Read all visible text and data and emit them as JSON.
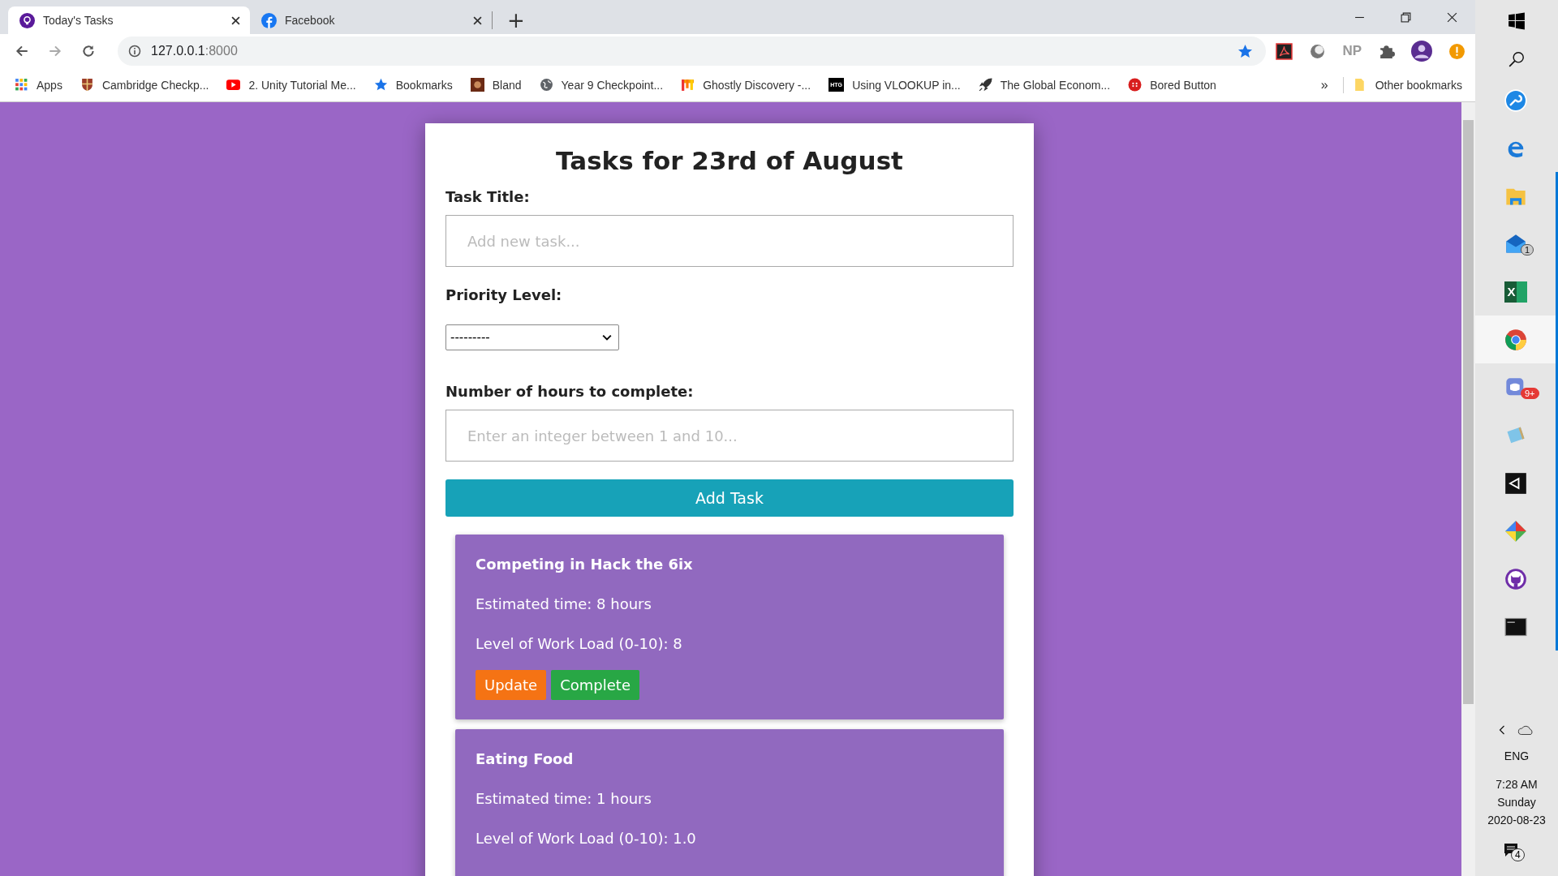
{
  "browser": {
    "tabs": [
      {
        "title": "Today's Tasks",
        "kind": "app",
        "selected": true
      },
      {
        "title": "Facebook",
        "kind": "facebook",
        "selected": false
      }
    ],
    "new_tab": "+",
    "address": {
      "host": "127.0.0.1",
      "port": ":8000"
    },
    "extension_label": "NP",
    "bookmarks": [
      {
        "label": "Apps",
        "kind": "apps"
      },
      {
        "label": "Cambridge Checkp...",
        "kind": "shield"
      },
      {
        "label": "2. Unity Tutorial Me...",
        "kind": "video"
      },
      {
        "label": "Bookmarks",
        "kind": "star"
      },
      {
        "label": "Bland",
        "kind": "photo"
      },
      {
        "label": "Year 9 Checkpoint...",
        "kind": "globe"
      },
      {
        "label": "Ghostly Discovery -...",
        "kind": "bars"
      },
      {
        "label": "Using VLOOKUP in...",
        "kind": "htg",
        "icon_text": "HTG"
      },
      {
        "label": "The Global Econom...",
        "kind": "rocket"
      },
      {
        "label": "Bored Button",
        "kind": "redbutton"
      }
    ],
    "more": "»",
    "other_bookmarks": "Other bookmarks"
  },
  "page": {
    "heading": "Tasks for 23rd of August",
    "form": {
      "title_label": "Task Title:",
      "title_placeholder": "Add new task...",
      "priority_label": "Priority Level:",
      "priority_value": "---------",
      "hours_label": "Number of hours to complete:",
      "hours_placeholder": "Enter an integer between 1 and 10...",
      "submit": "Add Task"
    },
    "tasks": [
      {
        "title": "Competing in Hack the 6ix",
        "time": "Estimated time: 8 hours",
        "load": "Level of Work Load (0-10): 8",
        "update": "Update",
        "complete": "Complete"
      },
      {
        "title": "Eating Food",
        "time": "Estimated time: 1 hours",
        "load": "Level of Work Load (0-10): 1.0"
      }
    ]
  },
  "taskbar": {
    "apps": [
      {
        "kind": "tool",
        "running": false,
        "selected": false
      },
      {
        "kind": "edge",
        "running": false,
        "selected": false
      },
      {
        "kind": "folder",
        "running": true,
        "selected": false
      },
      {
        "kind": "mail",
        "running": true,
        "selected": false,
        "badge": "1"
      },
      {
        "kind": "excel",
        "running": true,
        "selected": false,
        "icon_text": "X"
      },
      {
        "kind": "chrome",
        "running": true,
        "selected": true
      },
      {
        "kind": "discord",
        "running": true,
        "selected": false,
        "badge": "9+"
      },
      {
        "kind": "notepad",
        "running": true,
        "selected": false
      },
      {
        "kind": "unity",
        "running": true,
        "selected": false
      },
      {
        "kind": "git",
        "running": true,
        "selected": false
      },
      {
        "kind": "github",
        "running": true,
        "selected": false
      },
      {
        "kind": "terminal",
        "running": true,
        "selected": false
      }
    ],
    "language": "ENG",
    "time": "7:28 AM",
    "day": "Sunday",
    "date": "2020-08-23",
    "notifications": "4"
  }
}
